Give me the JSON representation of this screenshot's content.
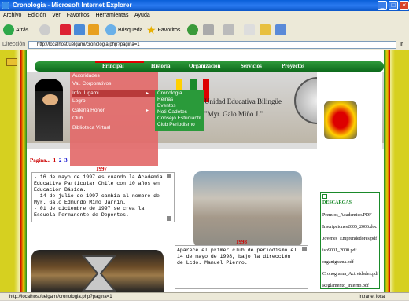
{
  "window": {
    "title": "Cronologia - Microsoft Internet Explorer"
  },
  "menubar": {
    "items": [
      "Archivo",
      "Edición",
      "Ver",
      "Favoritos",
      "Herramientas",
      "Ayuda"
    ]
  },
  "toolbar": {
    "back": "Atrás",
    "search": "Búsqueda",
    "favorites": "Favoritos"
  },
  "address": {
    "label": "Dirección",
    "url": "http://localhost/uelgami/cronologia.php?pagina=1",
    "go": "Ir"
  },
  "nav": {
    "items": [
      "Principal",
      "Historia",
      "Organización",
      "Servicios",
      "Proyectos"
    ]
  },
  "dropdown_principal": [
    "Autoridades",
    "Val. Corporativos",
    "Info. Ligami",
    "Logro",
    "Galería Honor",
    "Club",
    "Biblioteca Virtual"
  ],
  "dropdown_info": [
    "Cronologia",
    "Reinas",
    "Eventos",
    "Noti-Cadetes",
    "Consejo Estudiantil",
    "Club Periodismo"
  ],
  "banner": {
    "title": "Unidad Educativa Bilingüe",
    "subtitle": "\"Myr. Galo Miño J.\""
  },
  "pagination": {
    "label": "Pagina...",
    "pages": [
      "1",
      "2",
      "3"
    ]
  },
  "timeline": [
    {
      "year": "1997",
      "text": "- 16 de mayo de 1997 es cuando la Academia Educativa Particular Chile con 10 años en Educación Básica.\n- 14 de julio de 1997 cambia al nombre de Myr. Galo Edmundo Miño Jarrín.\n- 01 de diciembre de 1997 se crea la Escuela Permanente de Deportes."
    },
    {
      "year": "1998",
      "text": "Aparece el primer club de periodismo el 14 de mayo de 1998, bajo la dirección de Lcdo. Manuel Pierro."
    }
  ],
  "downloads": {
    "title": "DESCARGAS",
    "files": [
      "Premios_Academico.PDF",
      "Inscripciones2005_2006.doc",
      "Jovenes_Emprendedores.pdf",
      "iso9001_2000.pdf",
      "organigrama.pdf",
      "Cronograma_Actividades.pdf",
      "Reglamento_Interno.pdf"
    ]
  },
  "status": {
    "url": "http://localhost/uelgami/cronologia.php?pagina=1",
    "zone": "Intranet local"
  }
}
